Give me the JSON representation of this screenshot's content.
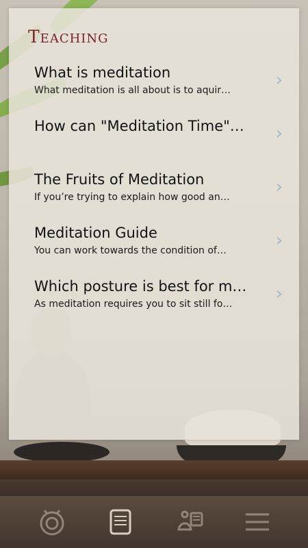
{
  "header": {
    "title": "Teaching"
  },
  "items": [
    {
      "title": "What is meditation",
      "subtitle": "What meditation is all about is to aquir…"
    },
    {
      "title": "How can \"Meditation Time\"…",
      "subtitle": ""
    },
    {
      "title": "The Fruits of Meditation",
      "subtitle": "If you’re trying to explain how good an…"
    },
    {
      "title": "Meditation Guide",
      "subtitle": "You can work towards the condition of…"
    },
    {
      "title": "Which posture is best for m…",
      "subtitle": "As meditation requires you to sit still fo…"
    }
  ],
  "tabbar": {
    "tabs": [
      {
        "name": "timer-icon",
        "active": false
      },
      {
        "name": "scroll-icon",
        "active": true
      },
      {
        "name": "meditation-guide-icon",
        "active": false
      },
      {
        "name": "menu-icon",
        "active": false
      }
    ]
  },
  "colors": {
    "title": "#7b1f2a",
    "chevron": "#a9b5c5",
    "tabbar": "#4b3d34"
  }
}
